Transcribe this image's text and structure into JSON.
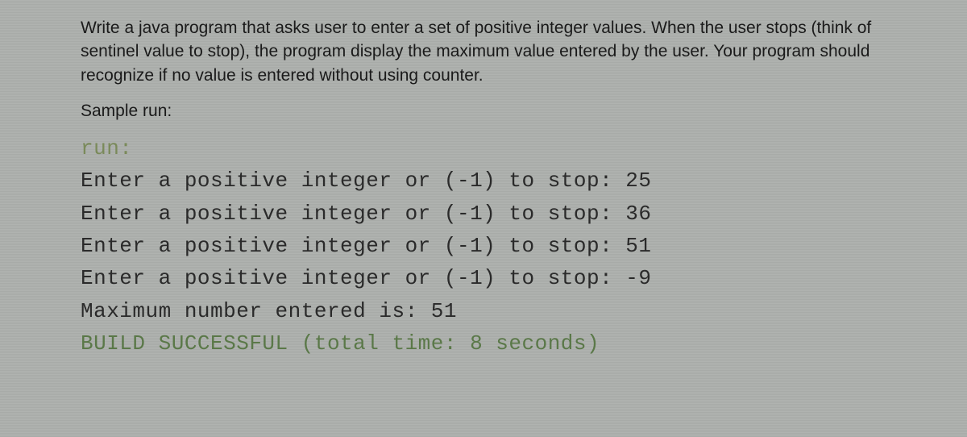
{
  "description": "Write a java program that asks user to enter a set of positive integer values. When the user stops (think of sentinel value to stop), the program display the maximum value entered by the user. Your program should recognize if no value is entered without using counter.",
  "sampleLabel": "Sample run:",
  "runLabel": "run:",
  "consoleLines": [
    "Enter a positive integer or (-1) to stop: 25",
    "Enter a positive integer or (-1) to stop: 36",
    "Enter a positive integer or (-1) to stop: 51",
    "Enter a positive integer or (-1) to stop: -9",
    "Maximum number entered is: 51"
  ],
  "buildLine": "BUILD SUCCESSFUL (total time: 8 seconds)"
}
